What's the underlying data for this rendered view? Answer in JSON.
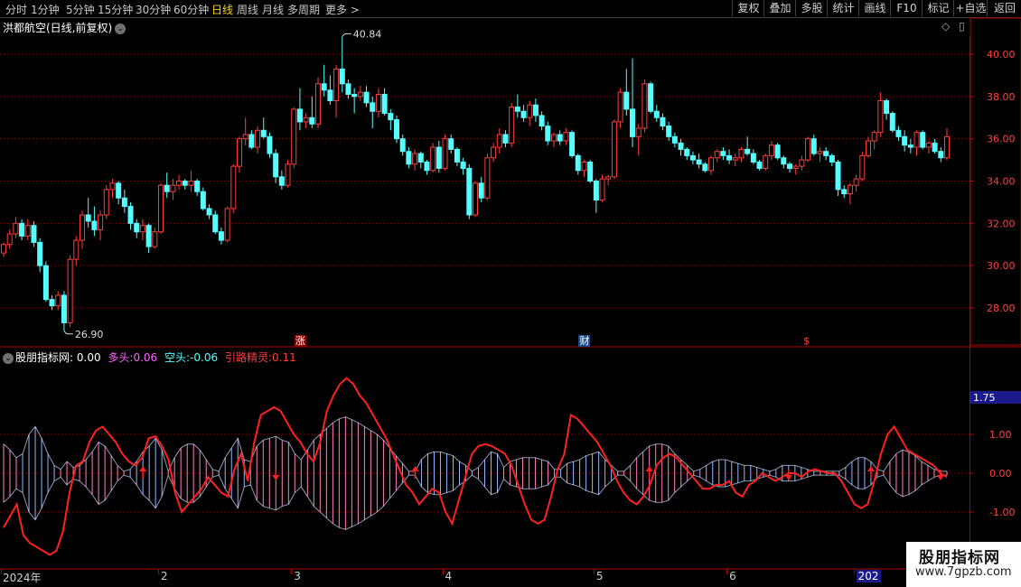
{
  "toolbar": {
    "periods": [
      "分时",
      "1分钟",
      "5分钟",
      "15分钟",
      "30分钟",
      "60分钟",
      "日线",
      "周线",
      "月线",
      "多周期",
      "更多 >"
    ],
    "active_period": "日线",
    "right_buttons": [
      "复权",
      "叠加",
      "多股",
      "统计",
      "画线",
      "F10",
      "标记",
      "+自选",
      "返回"
    ]
  },
  "stock_title": "洪都航空(日线,前复权)",
  "price_axis": {
    "labels": [
      "40.00",
      "38.00",
      "36.00",
      "34.00",
      "32.00",
      "30.00",
      "28.00"
    ],
    "values": [
      40,
      38,
      36,
      34,
      32,
      30,
      28
    ]
  },
  "annotations": {
    "high": "40.84",
    "low": "26.90"
  },
  "events": [
    {
      "label": "涨",
      "bar": 49
    },
    {
      "label": "财",
      "bar": 96
    },
    {
      "label": "$",
      "bar": 133
    }
  ],
  "indicator": {
    "name": "股朋指标网",
    "main_value": ": 0.00",
    "duo_label": "多头:",
    "duo_value": "0.06",
    "kong_label": "空头:",
    "kong_value": "-0.06",
    "yin_label": "引路精灵:",
    "yin_value": "0.11",
    "axis_labels": [
      "1.00",
      "0.00",
      "-1.00"
    ],
    "axis_values": [
      1,
      0,
      -1
    ],
    "current_tag": "1.75"
  },
  "dates": [
    {
      "label": "2024年",
      "bar": 0
    },
    {
      "label": "2",
      "bar": 26
    },
    {
      "label": "3",
      "bar": 48
    },
    {
      "label": "4",
      "bar": 73
    },
    {
      "label": "5",
      "bar": 98
    },
    {
      "label": "6",
      "bar": 120
    },
    {
      "label": "202",
      "bar": 141
    }
  ],
  "watermark": {
    "line1": "股朋指标网",
    "line2": "www.7gpzb.com"
  },
  "colors": {
    "up": "#ff3c3c",
    "down": "#54ffff",
    "grid": "#8b0000",
    "yin": "#ff2020",
    "duo": "#ff80c0",
    "kong": "#8fb8ff"
  },
  "chart_data": {
    "type": "candlestick",
    "x_range": [
      "2024-01",
      "2024-07"
    ],
    "y_range": [
      26.5,
      41.5
    ],
    "ohlc": [
      [
        30.6,
        31.1,
        30.4,
        31.0
      ],
      [
        31.0,
        31.7,
        30.8,
        31.5
      ],
      [
        31.5,
        32.3,
        31.3,
        32.0
      ],
      [
        32.0,
        32.2,
        31.2,
        31.4
      ],
      [
        31.4,
        32.2,
        31.2,
        31.9
      ],
      [
        31.9,
        32.1,
        30.9,
        31.1
      ],
      [
        31.1,
        31.3,
        29.7,
        30.0
      ],
      [
        30.0,
        30.2,
        28.3,
        28.4
      ],
      [
        28.4,
        28.6,
        27.9,
        28.1
      ],
      [
        28.1,
        28.8,
        27.9,
        28.6
      ],
      [
        28.6,
        28.8,
        26.9,
        27.3
      ],
      [
        27.3,
        30.5,
        27.1,
        30.3
      ],
      [
        30.3,
        31.4,
        30.0,
        31.2
      ],
      [
        31.2,
        32.6,
        30.8,
        32.4
      ],
      [
        32.4,
        33.2,
        31.8,
        32.1
      ],
      [
        32.1,
        32.8,
        31.4,
        31.7
      ],
      [
        31.7,
        32.6,
        31.2,
        32.4
      ],
      [
        32.4,
        33.8,
        32.2,
        33.6
      ],
      [
        33.6,
        34.1,
        33.2,
        33.9
      ],
      [
        33.9,
        34.0,
        32.9,
        33.2
      ],
      [
        33.2,
        33.6,
        32.5,
        32.8
      ],
      [
        32.8,
        33.0,
        31.7,
        32.0
      ],
      [
        32.0,
        32.2,
        31.3,
        31.6
      ],
      [
        31.6,
        32.2,
        31.2,
        31.9
      ],
      [
        31.9,
        32.0,
        30.6,
        30.9
      ],
      [
        30.9,
        31.8,
        30.8,
        31.6
      ],
      [
        31.6,
        33.9,
        31.5,
        33.8
      ],
      [
        33.8,
        34.4,
        33.2,
        33.5
      ],
      [
        33.5,
        34.1,
        33.1,
        33.8
      ],
      [
        33.8,
        34.3,
        33.6,
        34.0
      ],
      [
        34.0,
        34.1,
        33.6,
        33.8
      ],
      [
        33.8,
        34.5,
        33.5,
        34.0
      ],
      [
        34.0,
        34.1,
        33.3,
        33.5
      ],
      [
        33.5,
        33.7,
        32.6,
        32.7
      ],
      [
        32.7,
        32.9,
        32.2,
        32.4
      ],
      [
        32.4,
        32.6,
        31.5,
        31.6
      ],
      [
        31.6,
        31.8,
        31.0,
        31.2
      ],
      [
        31.2,
        32.8,
        31.1,
        32.7
      ],
      [
        32.7,
        34.8,
        32.5,
        34.7
      ],
      [
        34.7,
        36.1,
        34.4,
        36.0
      ],
      [
        36.0,
        37.0,
        35.7,
        36.2
      ],
      [
        36.2,
        36.4,
        35.5,
        35.6
      ],
      [
        35.6,
        36.6,
        35.3,
        36.4
      ],
      [
        36.4,
        37.0,
        36.0,
        36.1
      ],
      [
        36.1,
        36.3,
        35.1,
        35.3
      ],
      [
        35.3,
        35.5,
        33.9,
        34.2
      ],
      [
        34.2,
        34.5,
        33.6,
        33.8
      ],
      [
        33.8,
        35.0,
        33.7,
        34.8
      ],
      [
        34.8,
        37.5,
        34.6,
        37.4
      ],
      [
        37.4,
        38.4,
        36.4,
        36.8
      ],
      [
        36.8,
        37.2,
        36.5,
        37.0
      ],
      [
        37.0,
        38.0,
        36.5,
        36.7
      ],
      [
        36.7,
        38.9,
        36.5,
        38.6
      ],
      [
        38.6,
        39.5,
        38.0,
        38.3
      ],
      [
        38.3,
        39.0,
        37.6,
        37.8
      ],
      [
        37.8,
        39.5,
        37.0,
        39.3
      ],
      [
        39.3,
        40.84,
        38.2,
        38.6
      ],
      [
        38.6,
        38.8,
        37.9,
        38.1
      ],
      [
        38.1,
        38.4,
        37.2,
        38.0
      ],
      [
        38.0,
        38.5,
        37.8,
        38.2
      ],
      [
        38.2,
        38.5,
        37.5,
        37.7
      ],
      [
        37.7,
        38.0,
        36.5,
        37.3
      ],
      [
        37.3,
        38.4,
        37.0,
        38.1
      ],
      [
        38.1,
        38.4,
        37.1,
        37.2
      ],
      [
        37.2,
        37.4,
        36.4,
        36.9
      ],
      [
        36.9,
        37.1,
        35.8,
        36.0
      ],
      [
        36.0,
        36.2,
        35.2,
        35.4
      ],
      [
        35.4,
        35.6,
        34.6,
        34.8
      ],
      [
        34.8,
        35.5,
        34.5,
        35.3
      ],
      [
        35.3,
        35.4,
        34.6,
        34.9
      ],
      [
        34.9,
        35.0,
        34.3,
        34.5
      ],
      [
        34.5,
        35.8,
        34.4,
        35.6
      ],
      [
        35.6,
        35.9,
        34.4,
        34.6
      ],
      [
        34.6,
        36.2,
        34.5,
        36.0
      ],
      [
        36.0,
        36.2,
        35.3,
        35.5
      ],
      [
        35.5,
        35.6,
        34.7,
        34.9
      ],
      [
        34.9,
        35.1,
        34.3,
        34.6
      ],
      [
        34.6,
        34.8,
        32.2,
        32.4
      ],
      [
        32.4,
        34.0,
        32.3,
        33.9
      ],
      [
        33.9,
        34.2,
        33.0,
        33.2
      ],
      [
        33.2,
        35.3,
        33.1,
        35.1
      ],
      [
        35.1,
        35.8,
        34.9,
        35.6
      ],
      [
        35.6,
        36.5,
        35.3,
        36.2
      ],
      [
        36.2,
        36.4,
        35.6,
        35.8
      ],
      [
        35.8,
        37.7,
        35.6,
        37.5
      ],
      [
        37.5,
        38.1,
        37.0,
        37.3
      ],
      [
        37.3,
        37.6,
        36.8,
        37.0
      ],
      [
        37.0,
        37.8,
        36.6,
        37.6
      ],
      [
        37.6,
        37.9,
        36.8,
        37.1
      ],
      [
        37.1,
        37.3,
        36.4,
        36.6
      ],
      [
        36.6,
        36.8,
        35.7,
        35.9
      ],
      [
        35.9,
        36.3,
        35.6,
        36.2
      ],
      [
        36.2,
        36.4,
        35.7,
        35.9
      ],
      [
        35.9,
        36.5,
        35.7,
        36.3
      ],
      [
        36.3,
        36.4,
        35.1,
        35.2
      ],
      [
        35.2,
        35.3,
        34.3,
        34.5
      ],
      [
        34.5,
        35.0,
        34.2,
        34.9
      ],
      [
        34.9,
        35.0,
        33.9,
        34.0
      ],
      [
        34.0,
        34.1,
        32.5,
        33.1
      ],
      [
        33.1,
        34.3,
        33.0,
        34.1
      ],
      [
        34.1,
        34.3,
        33.8,
        34.2
      ],
      [
        34.2,
        36.9,
        34.1,
        36.8
      ],
      [
        36.8,
        38.4,
        36.5,
        38.2
      ],
      [
        38.2,
        39.3,
        37.1,
        37.4
      ],
      [
        37.4,
        39.8,
        35.6,
        36.1
      ],
      [
        36.1,
        36.7,
        35.2,
        36.5
      ],
      [
        36.5,
        38.8,
        36.3,
        38.6
      ],
      [
        38.6,
        38.7,
        37.2,
        37.3
      ],
      [
        37.3,
        37.6,
        36.8,
        37.0
      ],
      [
        37.0,
        37.2,
        36.4,
        36.6
      ],
      [
        36.6,
        36.8,
        35.9,
        36.1
      ],
      [
        36.1,
        36.3,
        35.6,
        35.8
      ],
      [
        35.8,
        36.0,
        35.2,
        35.5
      ],
      [
        35.5,
        35.6,
        35.0,
        35.2
      ],
      [
        35.2,
        35.4,
        34.8,
        35.0
      ],
      [
        35.0,
        35.3,
        34.6,
        34.8
      ],
      [
        34.8,
        34.9,
        34.4,
        34.5
      ],
      [
        34.5,
        35.2,
        34.3,
        35.1
      ],
      [
        35.1,
        35.5,
        34.9,
        35.4
      ],
      [
        35.4,
        35.6,
        35.0,
        35.2
      ],
      [
        35.2,
        35.5,
        34.8,
        35.0
      ],
      [
        35.0,
        35.3,
        34.7,
        35.1
      ],
      [
        35.1,
        35.6,
        34.9,
        35.5
      ],
      [
        35.5,
        36.1,
        35.2,
        35.3
      ],
      [
        35.3,
        35.5,
        34.8,
        34.9
      ],
      [
        34.9,
        35.0,
        34.5,
        34.6
      ],
      [
        34.6,
        35.3,
        34.5,
        35.2
      ],
      [
        35.2,
        35.9,
        35.0,
        35.7
      ],
      [
        35.7,
        35.8,
        35.0,
        35.1
      ],
      [
        35.1,
        35.2,
        34.6,
        34.8
      ],
      [
        34.8,
        34.9,
        34.4,
        34.6
      ],
      [
        34.6,
        34.8,
        34.3,
        34.7
      ],
      [
        34.7,
        35.2,
        34.5,
        35.0
      ],
      [
        35.0,
        36.1,
        34.9,
        36.0
      ],
      [
        36.0,
        36.2,
        35.2,
        35.3
      ],
      [
        35.3,
        35.6,
        34.9,
        35.4
      ],
      [
        35.4,
        35.6,
        35.0,
        35.2
      ],
      [
        35.2,
        35.3,
        34.7,
        34.9
      ],
      [
        34.9,
        35.0,
        33.3,
        33.6
      ],
      [
        33.6,
        33.8,
        33.2,
        33.4
      ],
      [
        33.4,
        33.9,
        32.9,
        33.8
      ],
      [
        33.8,
        34.3,
        33.5,
        34.1
      ],
      [
        34.1,
        35.4,
        34.0,
        35.2
      ],
      [
        35.2,
        36.1,
        35.1,
        35.9
      ],
      [
        35.9,
        36.4,
        35.5,
        36.3
      ],
      [
        36.3,
        38.2,
        36.1,
        37.8
      ],
      [
        37.8,
        37.9,
        36.9,
        37.2
      ],
      [
        37.2,
        37.3,
        36.3,
        36.4
      ],
      [
        36.4,
        36.6,
        35.9,
        36.1
      ],
      [
        36.1,
        36.4,
        35.4,
        35.7
      ],
      [
        35.7,
        36.0,
        35.3,
        35.6
      ],
      [
        35.6,
        36.4,
        35.2,
        36.3
      ],
      [
        36.3,
        36.4,
        35.5,
        35.6
      ],
      [
        35.6,
        35.9,
        35.3,
        35.8
      ],
      [
        35.8,
        36.0,
        35.3,
        35.4
      ],
      [
        35.4,
        35.6,
        34.9,
        35.1
      ],
      [
        35.1,
        36.5,
        35.0,
        36.1
      ]
    ],
    "indicator_series": {
      "osc": [
        0.75,
        0.6,
        0.4,
        -0.5,
        -1.0,
        -1.2,
        -0.9,
        -0.5,
        -0.2,
        0.1,
        0.3,
        0.15,
        0.2,
        0.35,
        0.55,
        0.8,
        0.7,
        0.45,
        0.2,
        0.05,
        -0.1,
        -0.3,
        -0.55,
        -0.7,
        -0.9,
        -0.6,
        0.05,
        0.4,
        0.65,
        0.75,
        0.75,
        0.6,
        0.35,
        0.1,
        -0.05,
        -0.4,
        -0.65,
        -0.9,
        -0.35,
        0.3,
        0.7,
        0.85,
        0.9,
        0.95,
        0.85,
        0.8,
        0.5,
        0.35,
        0.6,
        0.85,
        1.0,
        1.15,
        1.3,
        1.4,
        1.45,
        1.38,
        1.3,
        1.2,
        1.1,
        1.0,
        0.85,
        0.65,
        0.45,
        0.25,
        0.05,
        -0.05,
        -0.35,
        -0.5,
        -0.55,
        -0.55,
        -0.5,
        -0.45,
        -0.3,
        -0.2,
        -0.05,
        -0.15,
        -0.35,
        -0.55,
        -0.5,
        0.15,
        0.3,
        0.35,
        0.4,
        0.4,
        0.4,
        0.35,
        0.3,
        0.1,
        -0.1,
        -0.25,
        -0.3,
        -0.35,
        -0.45,
        -0.5,
        -0.55,
        -0.35,
        -0.2,
        -0.05,
        0.05,
        0.2,
        0.4,
        0.55,
        0.7,
        0.75,
        0.75,
        0.7,
        0.5,
        0.35,
        0.2,
        0.05,
        -0.1,
        -0.2,
        -0.3,
        -0.35,
        -0.35,
        -0.3,
        -0.25,
        -0.2,
        -0.2,
        -0.15,
        -0.1,
        -0.05,
        -0.1,
        -0.2,
        -0.2,
        -0.2,
        -0.15,
        -0.1,
        -0.05,
        -0.05,
        -0.05,
        -0.05,
        -0.05,
        -0.15,
        -0.3,
        -0.4,
        -0.4,
        -0.3,
        -0.1,
        0.05,
        0.3,
        0.5,
        0.6,
        0.55,
        0.45,
        0.3,
        0.2,
        0.1,
        0.05,
        0.05
      ],
      "yin": [
        -1.4,
        -1.1,
        -0.8,
        -1.6,
        -1.8,
        -1.9,
        -2.0,
        -2.1,
        -2.0,
        -1.5,
        -0.5,
        0.2,
        0.3,
        0.8,
        1.1,
        1.2,
        1.0,
        0.8,
        0.5,
        0.3,
        0.2,
        0.4,
        0.9,
        0.95,
        0.7,
        0.35,
        -0.5,
        -1.0,
        -0.8,
        -0.6,
        -0.4,
        -0.1,
        -0.3,
        -0.5,
        -0.6,
        0.1,
        0.5,
        -0.2,
        0.8,
        1.5,
        1.6,
        1.7,
        1.6,
        1.3,
        1.0,
        0.8,
        0.5,
        0.3,
        0.8,
        1.6,
        2.0,
        2.3,
        2.45,
        2.3,
        2.0,
        1.8,
        1.5,
        1.2,
        0.9,
        0.5,
        0.1,
        -0.3,
        -0.5,
        -0.8,
        -0.6,
        -0.4,
        -0.5,
        -1.0,
        -1.3,
        -0.7,
        -0.1,
        0.5,
        0.7,
        0.75,
        0.7,
        0.6,
        0.5,
        0.2,
        -0.3,
        -0.8,
        -1.2,
        -1.3,
        -1.2,
        -0.6,
        0.1,
        0.5,
        1.5,
        1.4,
        1.2,
        1.0,
        0.8,
        0.5,
        0.2,
        -0.2,
        -0.5,
        -0.7,
        -0.8,
        -0.6,
        -0.3,
        0.2,
        0.4,
        0.5,
        0.4,
        0.2,
        0.0,
        -0.2,
        -0.4,
        -0.4,
        -0.3,
        -0.3,
        -0.2,
        -0.5,
        -0.6,
        -0.3,
        -0.2,
        0.0,
        -0.1,
        -0.2,
        -0.1,
        0.0,
        0.0,
        -0.1,
        0.05,
        0.1,
        0.05,
        0.0,
        0.0,
        -0.2,
        -0.5,
        -0.8,
        -0.9,
        -0.8,
        -0.2,
        0.5,
        1.0,
        1.2,
        0.9,
        0.6,
        0.5,
        0.4,
        0.3,
        0.2,
        0.0,
        -0.1
      ]
    }
  }
}
